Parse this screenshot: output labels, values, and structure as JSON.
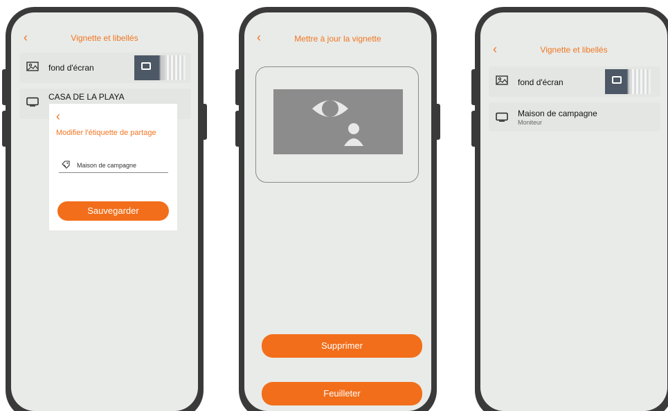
{
  "screens": [
    {
      "title": "Vignette et libellés",
      "rows": [
        {
          "label": "fond d'écran",
          "icon": "image-icon"
        },
        {
          "label": "CASA DE LA PLAYA",
          "icon": "monitor-icon"
        }
      ],
      "modal": {
        "title": "Modifier l'étiquette de partage",
        "field_value": "Maison de campagne",
        "save_label": "Sauvegarder"
      }
    },
    {
      "title": "Mettre à jour la vignette",
      "delete_label": "Supprimer",
      "browse_label": "Feuilleter"
    },
    {
      "title": "Vignette et libellés",
      "rows": [
        {
          "label": "fond d'écran",
          "icon": "image-icon"
        },
        {
          "label": "Maison de campagne",
          "sub": "Moniteur",
          "icon": "monitor-icon"
        }
      ]
    }
  ],
  "colors": {
    "accent": "#f07622",
    "button": "#f26e1a",
    "screen_bg": "#e9ebe8",
    "frame": "#3a3a3a"
  }
}
